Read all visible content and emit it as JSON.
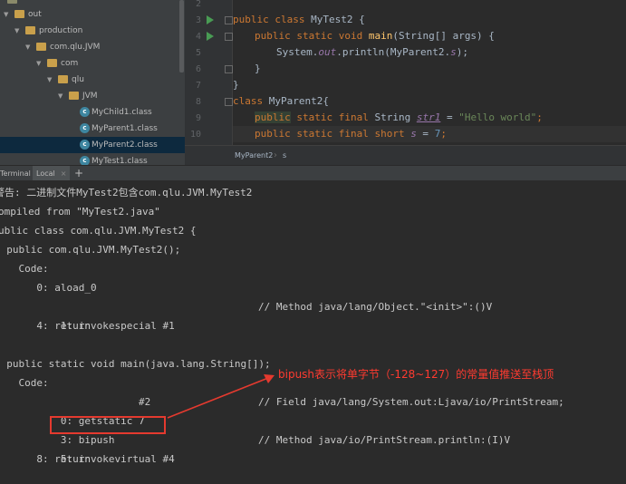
{
  "project_tree": {
    "items": [
      {
        "label": "out",
        "type": "folder",
        "expanded": true
      },
      {
        "label": "production",
        "type": "folder",
        "expanded": true
      },
      {
        "label": "com.qlu.JVM",
        "type": "folder",
        "expanded": true
      },
      {
        "label": "com",
        "type": "folder",
        "expanded": true
      },
      {
        "label": "qlu",
        "type": "folder",
        "expanded": true
      },
      {
        "label": "JVM",
        "type": "folder",
        "expanded": true
      },
      {
        "label": "MyChild1.class",
        "type": "class"
      },
      {
        "label": "MyParent1.class",
        "type": "class"
      },
      {
        "label": "MyParent2.class",
        "type": "class",
        "selected": true
      },
      {
        "label": "MyTest1.class",
        "type": "class"
      }
    ]
  },
  "editor": {
    "line_numbers": [
      "2",
      "3",
      "4",
      "5",
      "6",
      "7",
      "8",
      "9",
      "10"
    ],
    "lines": {
      "l3_kw": "public class ",
      "l3_name": "MyTest2 {",
      "l4_kw": "public static void ",
      "l4_fn": "main",
      "l4_rest": "(String[] args) {",
      "l5_a": "System.",
      "l5_b": "out",
      "l5_c": ".println(MyParent2.",
      "l5_d": "s",
      "l5_e": ");",
      "l6": "}",
      "l7": "}",
      "l8_kw": "class ",
      "l8_name": "MyParent2{",
      "l9_kw1": "public",
      "l9_kw2": " static final ",
      "l9_type": "String ",
      "l9_var": "str1",
      "l9_eq": " = ",
      "l9_str": "\"Hello world\"",
      "l9_end": ";",
      "l10_kw": "public static final short ",
      "l10_var": "s",
      "l10_eq": " = ",
      "l10_num": "7",
      "l10_end": ";"
    },
    "breadcrumb": [
      "MyParent2",
      "s"
    ]
  },
  "terminal": {
    "tabs": [
      "Terminal",
      "Local"
    ],
    "add_label": "+",
    "lines": [
      "警告: 二进制文件MyTest2包含com.qlu.JVM.MyTest2",
      "ompiled from \"MyTest2.java\"",
      "ublic class com.qlu.JVM.MyTest2 {",
      "  public com.qlu.JVM.MyTest2();",
      "    Code:",
      "       0: aload_0",
      "       1: invokespecial #1",
      "       4: return",
      "",
      "  public static void main(java.lang.String[]);",
      "    Code:",
      "       0: getstatic",
      "       3: bipush",
      "       5: invokevirtual #4",
      "       8: return"
    ],
    "operands": {
      "getstatic": "#2",
      "bipush": "7"
    },
    "comments": {
      "invokespecial": "// Method java/lang/Object.\"<init>\":()V",
      "getstatic": "// Field java/lang/System.out:Ljava/io/PrintStream;",
      "invokevirtual": "// Method java/io/PrintStream.println:(I)V"
    }
  },
  "annotation": {
    "text": "bipush表示将单字节（-128~127）的常量值推送至栈顶",
    "color": "#ff3b30"
  },
  "colors": {
    "keyword": "#cc7832",
    "function": "#ffc66d",
    "string": "#6a8759",
    "number": "#6897bb",
    "field": "#9876aa",
    "highlight_box": "#e53a2f"
  }
}
